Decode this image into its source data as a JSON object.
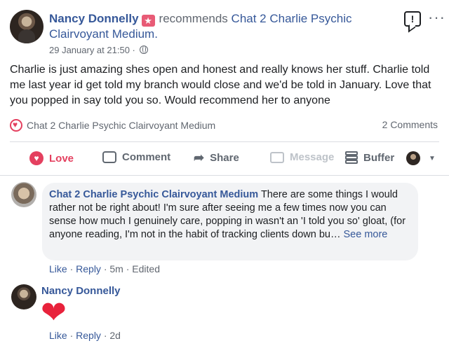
{
  "post": {
    "author": "Nancy Donnelly",
    "verb": "recommends",
    "page_name": "Chat 2 Charlie Psychic Clairvoyant Medium.",
    "timestamp": "29 January at 21:50",
    "separator": "·",
    "body": "Charlie is just amazing shes open and honest and really knows her stuff. Charlie told me last year id get told my branch would close and we'd be told in January. Love that you popped in say told you so. Would recommend her to anyone",
    "recommended_page": "Chat 2 Charlie Psychic Clairvoyant Medium",
    "comment_count": "2 Comments",
    "report_icon": "!",
    "more_icon": "···",
    "brand_color": "#365899",
    "love_color": "#e4405f"
  },
  "actions": {
    "love": "Love",
    "comment": "Comment",
    "share": "Share",
    "message": "Message",
    "buffer": "Buffer"
  },
  "comments": [
    {
      "author": "Chat 2 Charlie Psychic Clairvoyant Medium",
      "text": "There are some things I would rather not be right about! I'm sure after seeing me a few times now you can sense how much I genuinely care, popping in wasn't an 'I told you so' gloat, (for anyone reading, I'm not in the habit of tracking clients down bu…",
      "see_more": "See more",
      "like": "Like",
      "reply": "Reply",
      "age": "5m",
      "edited": "Edited"
    },
    {
      "author": "Nancy Donnelly",
      "reaction": "❤",
      "like": "Like",
      "reply": "Reply",
      "age": "2d"
    }
  ]
}
